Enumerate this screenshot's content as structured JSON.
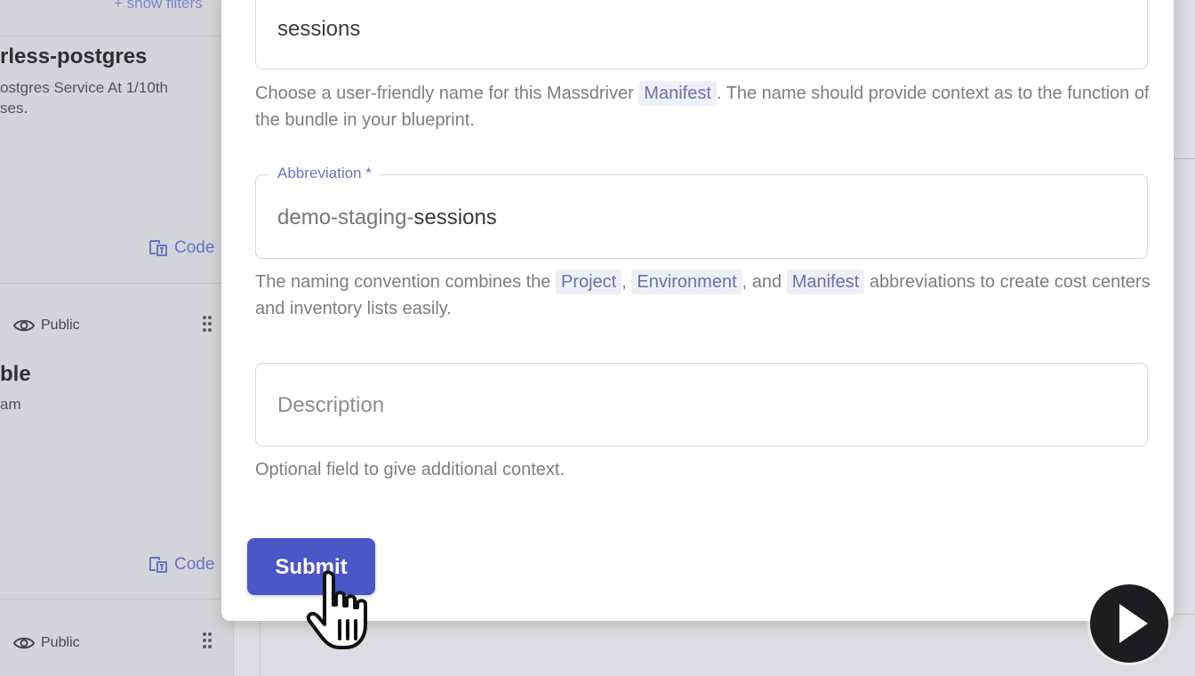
{
  "background": {
    "show_filters": "+ show filters",
    "cards": [
      {
        "title": "rless-postgres",
        "description": "ostgres Service At 1/10th\nses.",
        "code_label": "Code"
      },
      {
        "visibility": "Public",
        "title": "ble",
        "description": "am",
        "code_label": "Code"
      },
      {
        "visibility": "Public"
      }
    ]
  },
  "form": {
    "name_field": {
      "value": "sessions",
      "helper_before": "Choose a user-friendly name for this Massdriver",
      "helper_chip": "Manifest",
      "helper_after": ". The name should provide context as to the function of the bundle in your blueprint."
    },
    "abbreviation_field": {
      "label": "Abbreviation *",
      "prefix": "demo-staging-",
      "value": "sessions",
      "helper_1": "The naming convention combines the",
      "chip_project": "Project",
      "helper_2": ",",
      "chip_environment": "Environment",
      "helper_3": ", and",
      "chip_manifest": "Manifest",
      "helper_4": "abbreviations to create cost centers and inventory lists easily."
    },
    "description_field": {
      "placeholder": "Description",
      "helper": "Optional field to give additional context."
    },
    "submit_label": "Submit"
  },
  "colors": {
    "accent": "#4a57c7",
    "chip_bg": "#eef0f8",
    "label": "#6a72c3"
  }
}
